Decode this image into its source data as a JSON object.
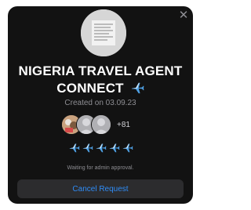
{
  "dialog": {
    "close_icon": "close-icon",
    "group_avatar_icon": "group-avatar-image",
    "title_line_1": "NIGERIA TRAVEL AGENT",
    "title_line_2": "CONNECT",
    "title_emoji": "airplane-icon",
    "created": "Created on 03.09.23",
    "member_count": "+81",
    "description_emojis": [
      "airplane-icon",
      "airplane-icon",
      "airplane-icon",
      "airplane-icon",
      "airplane-icon"
    ],
    "status": "Waiting for admin approval.",
    "cancel_label": "Cancel Request"
  },
  "colors": {
    "card_bg": "#121212",
    "accent": "#2f8cf6",
    "muted_text": "#8e8e93",
    "button_bg": "#2c2c2e"
  }
}
